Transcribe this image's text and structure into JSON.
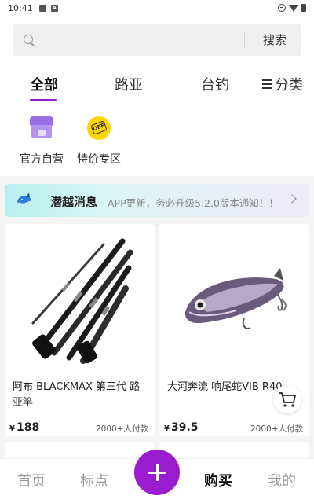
{
  "status_bar": {
    "time": "10:41",
    "icon1": "image-icon",
    "icon2": "a-icon"
  },
  "search": {
    "placeholder": "",
    "button_label": "搜索"
  },
  "tabs": [
    {
      "label": "全部",
      "active": true
    },
    {
      "label": "路亚",
      "active": false
    },
    {
      "label": "台钓",
      "active": false
    },
    {
      "label": "分类",
      "active": false,
      "icon": "menu-icon"
    }
  ],
  "quick_entries": [
    {
      "label": "官方自营",
      "icon": "shop-icon"
    },
    {
      "label": "特价专区",
      "icon": "off-sale-icon"
    }
  ],
  "notice": {
    "title": "潜越消息",
    "text": "APP更新，务必升级5.2.0版本通知！！",
    "accent": "#b8f0f0"
  },
  "products": [
    {
      "title": "阿布 BLACKMAX 第三代 路亚竿",
      "currency": "¥",
      "price": "188",
      "sales": "2000+人付款"
    },
    {
      "title": "大河奔流 响尾蛇VIB R40",
      "currency": "¥",
      "price": "39.5",
      "sales": "2000+人付款"
    }
  ],
  "bottom_nav": {
    "items": [
      {
        "label": "首页",
        "active": false
      },
      {
        "label": "标点",
        "active": false
      },
      {
        "label": "购买",
        "active": true
      },
      {
        "label": "我的",
        "active": false
      }
    ],
    "fab_icon": "plus-icon",
    "fab_color": "#9a1ccf"
  },
  "colors": {
    "accent": "#8b1fc9",
    "background": "#f4f4f4"
  }
}
